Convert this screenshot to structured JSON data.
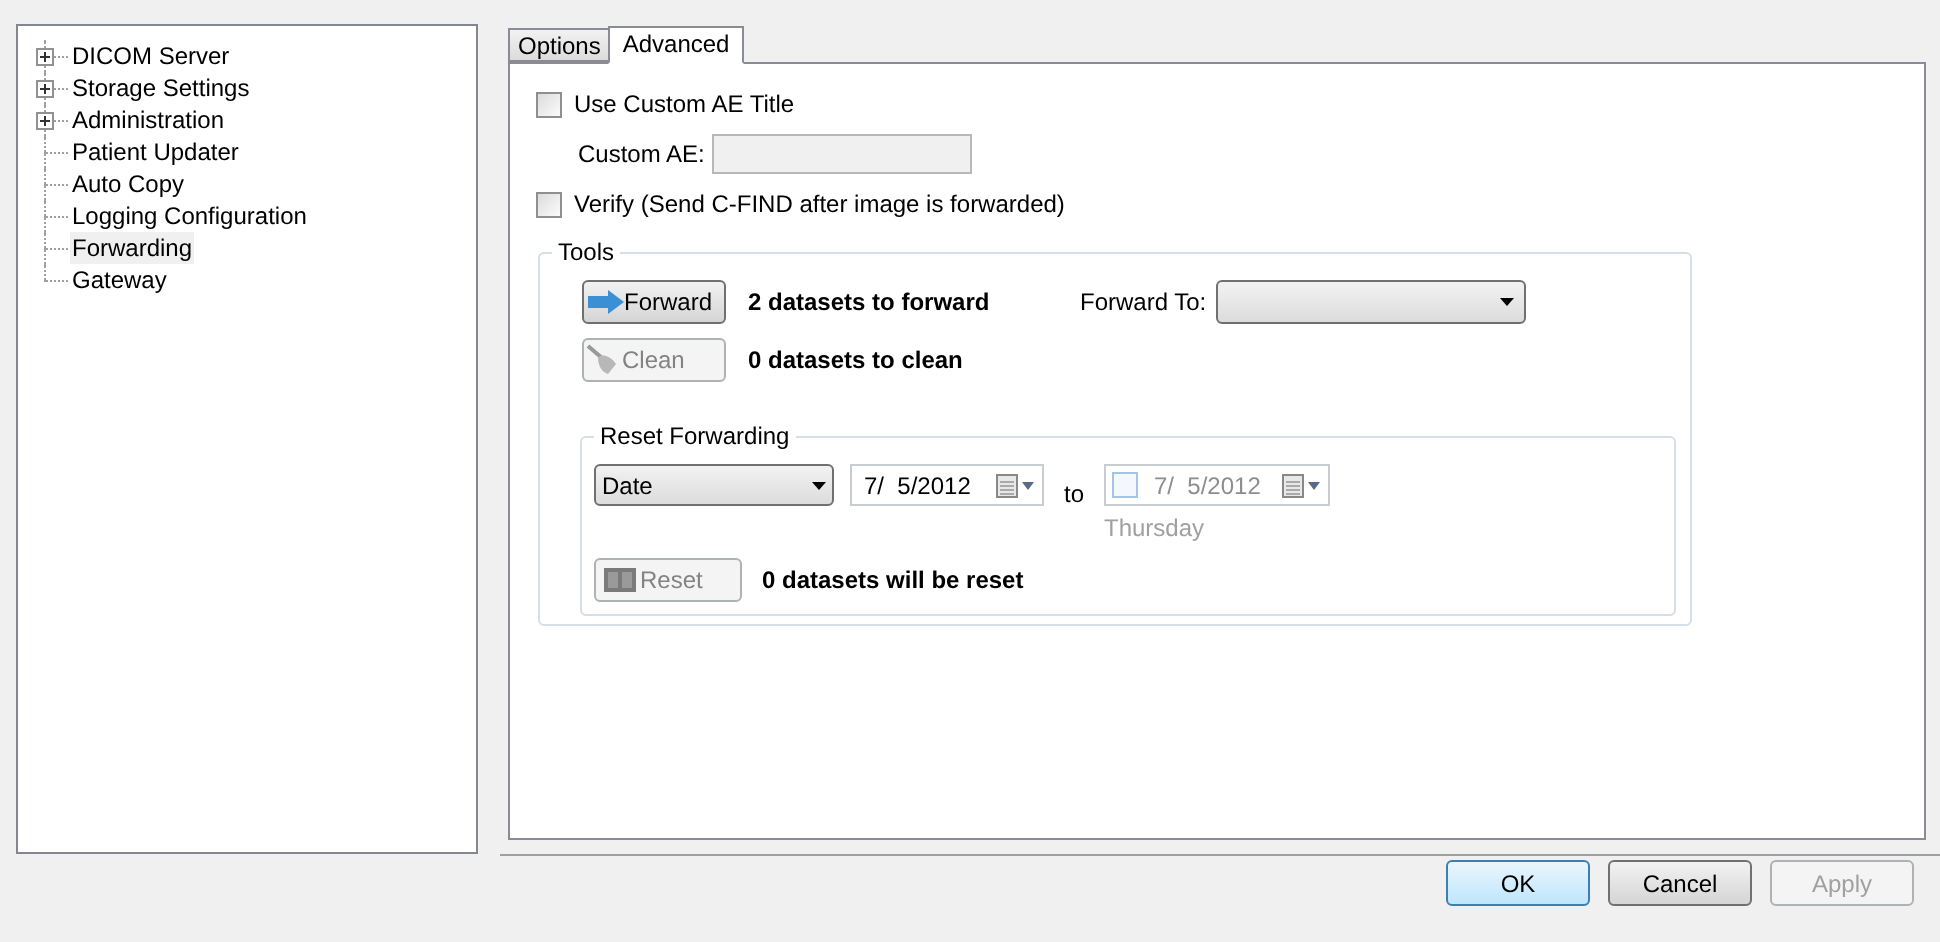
{
  "tree": [
    {
      "label": "DICOM Server",
      "expandable": true,
      "selected": false
    },
    {
      "label": "Storage Settings",
      "expandable": true,
      "selected": false
    },
    {
      "label": "Administration",
      "expandable": true,
      "selected": false
    },
    {
      "label": "Patient Updater",
      "expandable": false,
      "selected": false
    },
    {
      "label": "Auto Copy",
      "expandable": false,
      "selected": false
    },
    {
      "label": "Logging Configuration",
      "expandable": false,
      "selected": false
    },
    {
      "label": "Forwarding",
      "expandable": false,
      "selected": true
    },
    {
      "label": "Gateway",
      "expandable": false,
      "selected": false
    }
  ],
  "tabs": [
    {
      "label": "Options",
      "selected": false
    },
    {
      "label": "Advanced",
      "selected": true
    }
  ],
  "use_custom_ae": {
    "label": "Use Custom AE Title",
    "checked": false
  },
  "custom_ae": {
    "label": "Custom AE:",
    "disabled": true
  },
  "verify": {
    "label": "Verify (Send C-FIND after image is forwarded)",
    "checked": false
  },
  "tools": {
    "title": "Tools",
    "forward_button": {
      "label": "Forward",
      "disabled": false
    },
    "forward_status": "2 datasets to forward",
    "forward_to_label": "Forward To:",
    "clean_button": {
      "label": "Clean",
      "disabled": true
    },
    "clean_status": "0 datasets to clean",
    "reset_forwarding": {
      "title": "Reset Forwarding",
      "mode": "Date",
      "from_date": "7/  5/2012",
      "to_label": "to",
      "to_date": {
        "value": "7/  5/2012",
        "checked": false,
        "day": "Thursday"
      },
      "reset_button": {
        "label": "Reset",
        "disabled": true
      },
      "reset_status": "0 datasets will be reset"
    }
  },
  "buttons": [
    {
      "label": "OK",
      "disabled": false,
      "default": true
    },
    {
      "label": "Cancel",
      "disabled": false,
      "default": false
    },
    {
      "label": "Apply",
      "disabled": true,
      "default": false
    }
  ]
}
